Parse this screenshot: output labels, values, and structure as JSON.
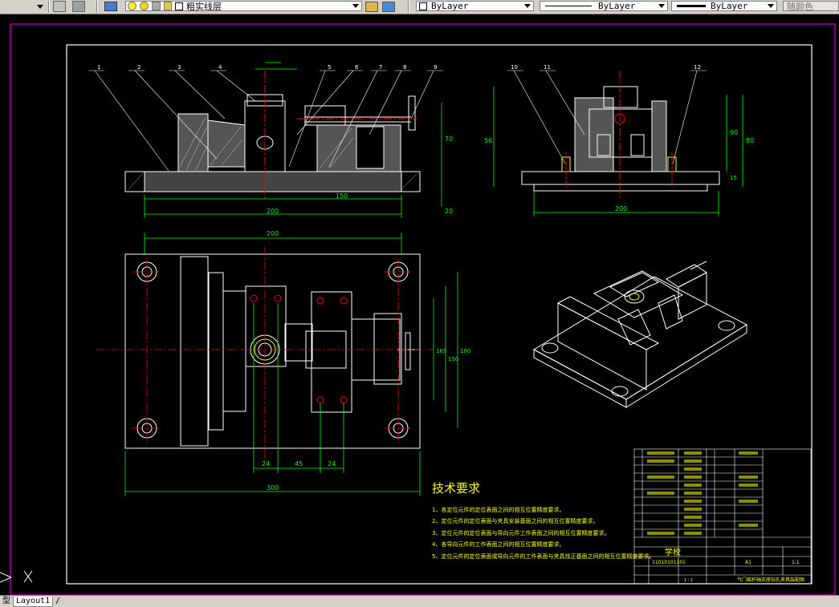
{
  "toolbar": {
    "layer_name": "粗实线层",
    "color": "ByLayer",
    "linetype": "ByLayer",
    "lineweight": "ByLayer",
    "plotstyle": "随颜色"
  },
  "tabs": {
    "model": "型",
    "layout1": "Layout1",
    "separator": "/"
  },
  "drawing": {
    "tech_title": "技术要求",
    "tech_items": [
      "1、各定位元件的定位表面之间的相互位置精度要求。",
      "2、定位元件的定位表面与夹具安装基面之间的相互位置精度要求。",
      "3、定位元件的定位表面与导向元件工作表面之间的相互位置精度要求。",
      "4、各导向元件的工作表面之间的相互位置精度要求。",
      "5、定位元件的定位表面或导向元件的工作表面与夹具找正基面之间的相互位置精度要求。"
    ],
    "dims": {
      "d_front_base": "200",
      "d_front_inner": "150",
      "d_front_h": "70",
      "d_front_h2": "20",
      "d_side_w": "200",
      "d_side_h": "90",
      "d_side_h2": "80",
      "d_side_h3": "15",
      "d_side_left": "56",
      "d_top_w": "200",
      "d_top_bottom": "300",
      "d_top_24a": "24",
      "d_top_45": "45",
      "d_top_24b": "24",
      "d_top_h1": "165",
      "d_top_h2": "150",
      "d_top_h3": "180"
    },
    "balloons": [
      "1",
      "2",
      "3",
      "4",
      "5",
      "6",
      "7",
      "8",
      "9",
      "10",
      "11",
      "12"
    ],
    "title_block": {
      "school": "学校",
      "scale": "1:1",
      "drawing_name": "气门摇杆轴支座钻孔夹具装配图",
      "code1": "11010101101",
      "code2": "1 : 1",
      "sheet": "A1"
    }
  },
  "colors": {
    "background": "#000000",
    "frame": "#ff00ff",
    "line": "#ffffff",
    "dim": "#00ff00",
    "center": "#ff0000",
    "text": "#ffff00"
  }
}
